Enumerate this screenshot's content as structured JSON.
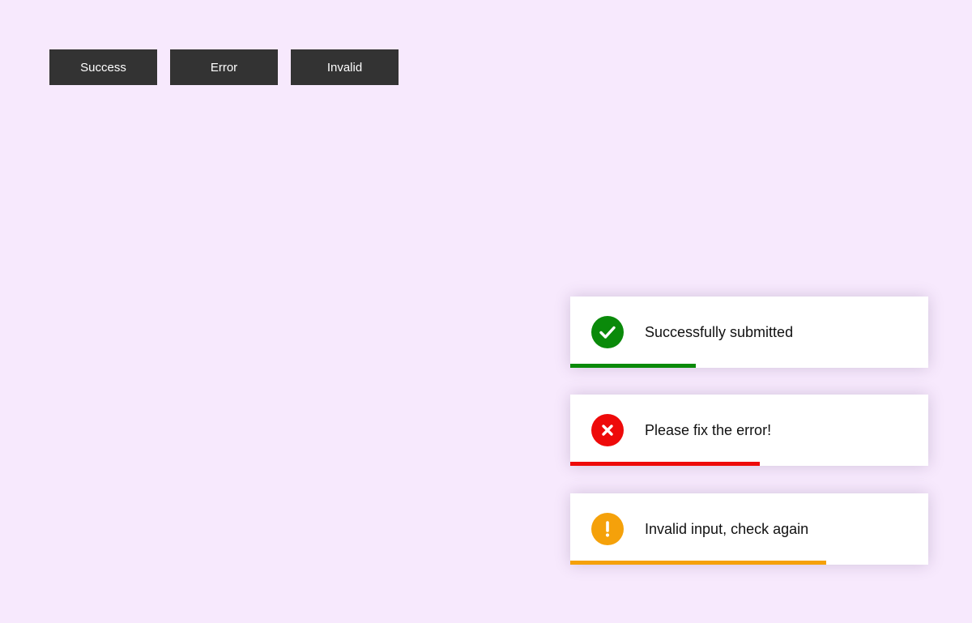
{
  "buttons": [
    {
      "label": "Success"
    },
    {
      "label": "Error"
    },
    {
      "label": "Invalid"
    }
  ],
  "toasts": [
    {
      "type": "success",
      "message": "Successfully submitted",
      "icon": "check-icon",
      "color": "#0a8a0a",
      "progress": 0.35
    },
    {
      "type": "error",
      "message": "Please fix the error!",
      "icon": "close-icon",
      "color": "#ee0a0a",
      "progress": 0.53
    },
    {
      "type": "invalid",
      "message": "Invalid input, check again",
      "icon": "exclamation-icon",
      "color": "#f5a10a",
      "progress": 0.714
    }
  ]
}
